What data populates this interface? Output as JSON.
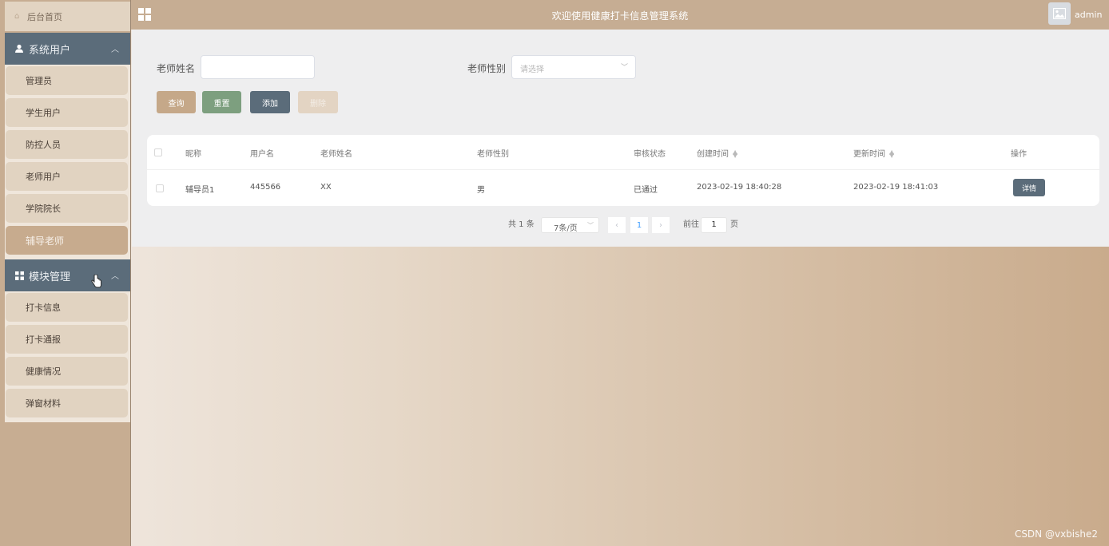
{
  "header": {
    "title": "欢迎使用健康打卡信息管理系统",
    "username": "admin"
  },
  "sidebar": {
    "home": "后台首页",
    "groups": [
      {
        "label": "系统用户",
        "items": [
          "管理员",
          "学生用户",
          "防控人员",
          "老师用户",
          "学院院长",
          "辅导老师"
        ],
        "active": "辅导老师"
      },
      {
        "label": "模块管理",
        "items": [
          "打卡信息",
          "打卡通报",
          "健康情况",
          "弹窗材料"
        ]
      }
    ]
  },
  "search": {
    "name_label": "老师姓名",
    "name_value": "",
    "gender_label": "老师性别",
    "gender_placeholder": "请选择"
  },
  "buttons": {
    "query": "查询",
    "reset": "重置",
    "add": "添加",
    "delete": "删除"
  },
  "table": {
    "columns": [
      "昵称",
      "用户名",
      "老师姓名",
      "老师性别",
      "审核状态",
      "创建时间",
      "更新时间",
      "操作"
    ],
    "rows": [
      {
        "nickname": "辅导员1",
        "username": "445566",
        "teacher_name": "XX",
        "gender": "男",
        "status": "已通过",
        "created": "2023-02-19 18:40:28",
        "updated": "2023-02-19 18:41:03",
        "action": "详情"
      }
    ]
  },
  "pagination": {
    "total": "共 1 条",
    "page_size": "7条/页",
    "current_page": "1",
    "goto_label": "前往",
    "goto_value": "1",
    "page_unit": "页"
  },
  "watermark": "CSDN @vxbishe2"
}
